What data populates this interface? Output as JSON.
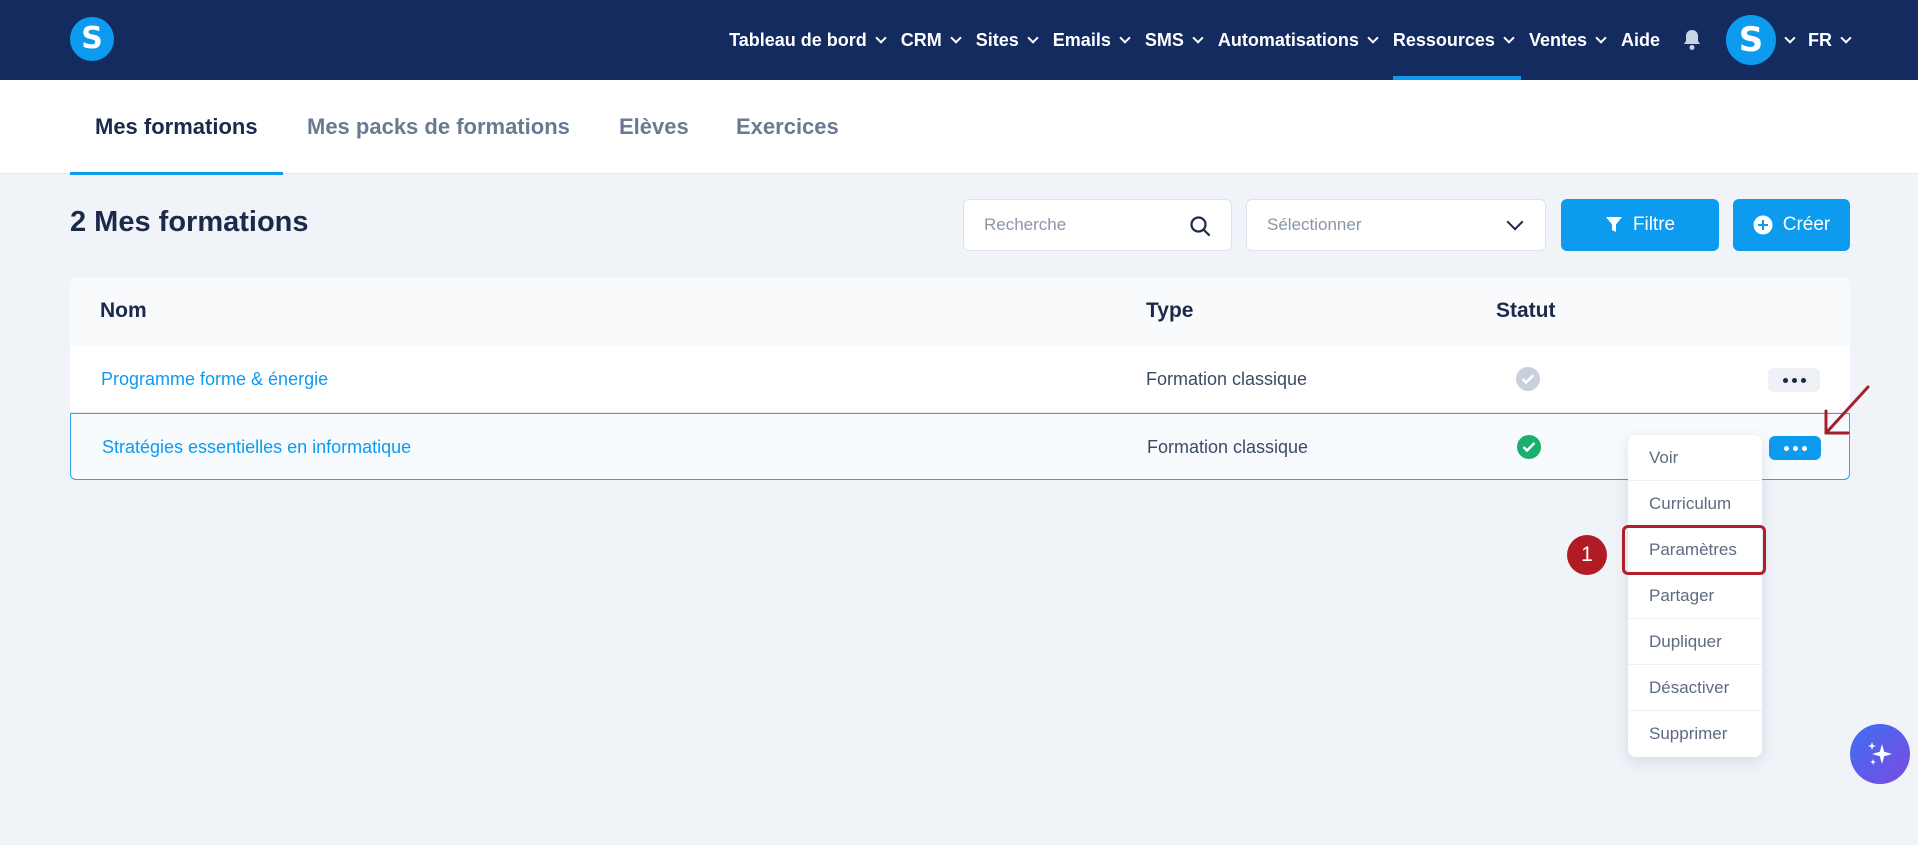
{
  "header": {
    "logo_letter": "S",
    "nav": [
      {
        "label": "Tableau de bord"
      },
      {
        "label": "CRM"
      },
      {
        "label": "Sites"
      },
      {
        "label": "Emails"
      },
      {
        "label": "SMS"
      },
      {
        "label": "Automatisations"
      },
      {
        "label": "Ressources",
        "active": true
      },
      {
        "label": "Ventes"
      }
    ],
    "help_label": "Aide",
    "avatar_letter": "S",
    "language": "FR"
  },
  "tabs": [
    {
      "label": "Mes formations",
      "active": true
    },
    {
      "label": "Mes packs de formations"
    },
    {
      "label": "Elèves"
    },
    {
      "label": "Exercices"
    }
  ],
  "page": {
    "title": "2 Mes formations",
    "search_placeholder": "Recherche",
    "select_placeholder": "Sélectionner",
    "filter_label": "Filtre",
    "create_label": "Créer"
  },
  "table": {
    "columns": [
      "Nom",
      "Type",
      "Statut"
    ],
    "rows": [
      {
        "name": "Programme forme & énergie",
        "type": "Formation classique",
        "status": "inactive"
      },
      {
        "name": "Stratégies essentielles en informatique",
        "type": "Formation classique",
        "status": "active"
      }
    ]
  },
  "menu": {
    "items": [
      "Voir",
      "Curriculum",
      "Paramètres",
      "Partager",
      "Dupliquer",
      "Désactiver",
      "Supprimer"
    ],
    "highlighted_index": 2
  },
  "annotation": {
    "step_number": "1"
  },
  "colors": {
    "navy": "#142b60",
    "accent": "#0d9bf0",
    "status_active": "#1aae6f",
    "status_inactive": "#c7d0dc",
    "annotation_red": "#b11b24"
  }
}
